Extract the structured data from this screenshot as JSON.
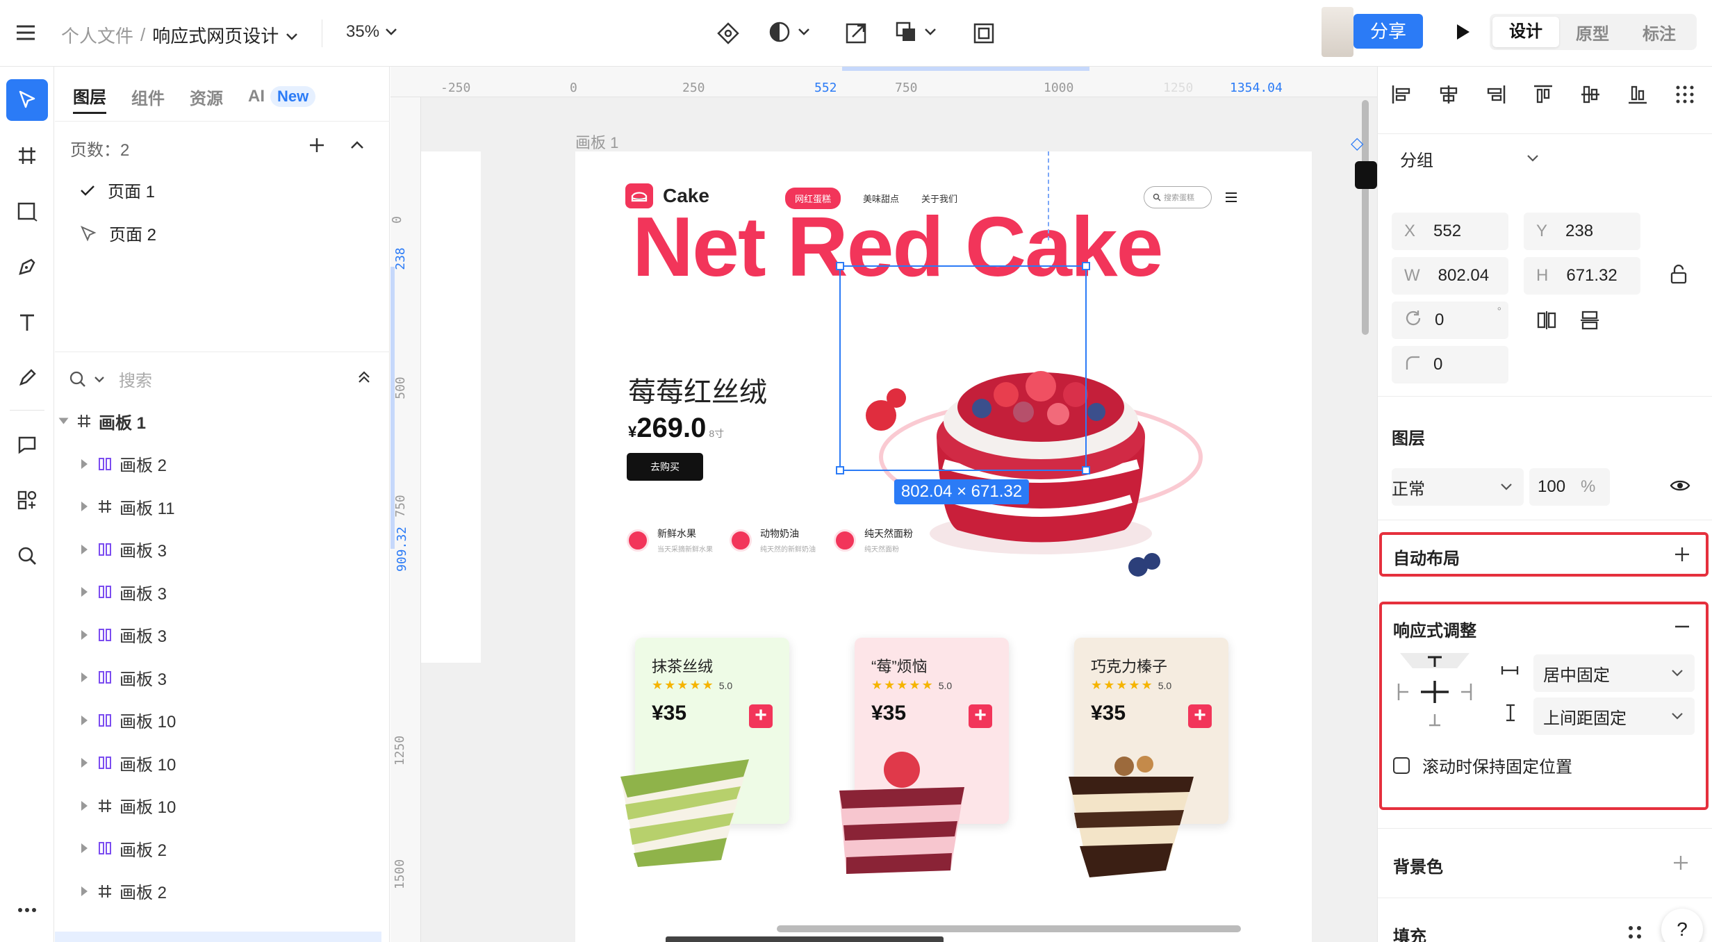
{
  "topbar": {
    "breadcrumb_root": "个人文件",
    "breadcrumb_sep": "/",
    "file_name": "响应式网页设计",
    "zoom": "35%",
    "share_label": "分享",
    "modes": [
      "设计",
      "原型",
      "标注"
    ]
  },
  "left_panel": {
    "tabs": [
      "图层",
      "组件",
      "资源",
      "AI"
    ],
    "ai_badge": "New",
    "pages_label": "页数：2",
    "pages": [
      "页面 1",
      "页面 2"
    ],
    "search_placeholder": "搜索",
    "layers": [
      {
        "name": "画板 1",
        "type": "board",
        "level": 0
      },
      {
        "name": "画板 2",
        "type": "auto",
        "level": 1
      },
      {
        "name": "画板 11",
        "type": "board",
        "level": 1
      },
      {
        "name": "画板 3",
        "type": "auto",
        "level": 1
      },
      {
        "name": "画板 3",
        "type": "auto",
        "level": 1
      },
      {
        "name": "画板 3",
        "type": "auto",
        "level": 1
      },
      {
        "name": "画板 3",
        "type": "auto",
        "level": 1
      },
      {
        "name": "画板 10",
        "type": "auto",
        "level": 1
      },
      {
        "name": "画板 10",
        "type": "auto",
        "level": 1
      },
      {
        "name": "画板 10",
        "type": "board",
        "level": 1
      },
      {
        "name": "画板 2",
        "type": "auto",
        "level": 1
      },
      {
        "name": "画板 2",
        "type": "board",
        "level": 1
      }
    ]
  },
  "canvas": {
    "ruler_top": [
      "-250",
      "0",
      "250",
      "552",
      "750",
      "1000",
      "1250",
      "1354.04"
    ],
    "ruler_left": [
      "0",
      "238",
      "500",
      "750",
      "909.32",
      "1250",
      "1500"
    ],
    "artboard_label": "画板 1",
    "selection_size": "802.04 × 671.32",
    "site": {
      "brand": "Cake",
      "nav": [
        "网红蛋糕",
        "美味甜点",
        "关于我们"
      ],
      "search_placeholder": "搜索蛋糕",
      "hero_title": "Net Red Cake",
      "product_name": "莓莓红丝绒",
      "currency": "¥",
      "price": "269.0",
      "size": "8寸",
      "buy_label": "去购买",
      "features": [
        {
          "title": "新鲜水果",
          "desc": "当天采摘新鲜水果"
        },
        {
          "title": "动物奶油",
          "desc": "纯天然的新鲜奶油"
        },
        {
          "title": "纯天然面粉",
          "desc": "纯天然面粉"
        }
      ],
      "cards": [
        {
          "name": "抹茶丝绒",
          "rating": "5.0",
          "price": "¥35",
          "bg": "#eefbe6"
        },
        {
          "name": "“莓”烦恼",
          "rating": "5.0",
          "price": "¥35",
          "bg": "#fde5e8"
        },
        {
          "name": "巧克力榛子",
          "rating": "5.0",
          "price": "¥35",
          "bg": "#f5ece0"
        }
      ]
    }
  },
  "right_panel": {
    "group_type": "分组",
    "x": "552",
    "y": "238",
    "w": "802.04",
    "h": "671.32",
    "rotation": "0",
    "radius": "0",
    "labels": {
      "x": "X",
      "y": "Y",
      "w": "W",
      "h": "H"
    },
    "layer_title": "图层",
    "blend_mode": "正常",
    "opacity": "100",
    "opacity_unit": "%",
    "auto_layout": "自动布局",
    "responsive_title": "响应式调整",
    "h_constraint": "居中固定",
    "v_constraint": "上间距固定",
    "fixed_scroll": "滚动时保持固定位置",
    "background_title": "背景色",
    "fill_title": "填充"
  },
  "colors": {
    "accent": "#2b7bf6",
    "brand_red": "#f2355a",
    "highlight_red": "#e5303d"
  }
}
